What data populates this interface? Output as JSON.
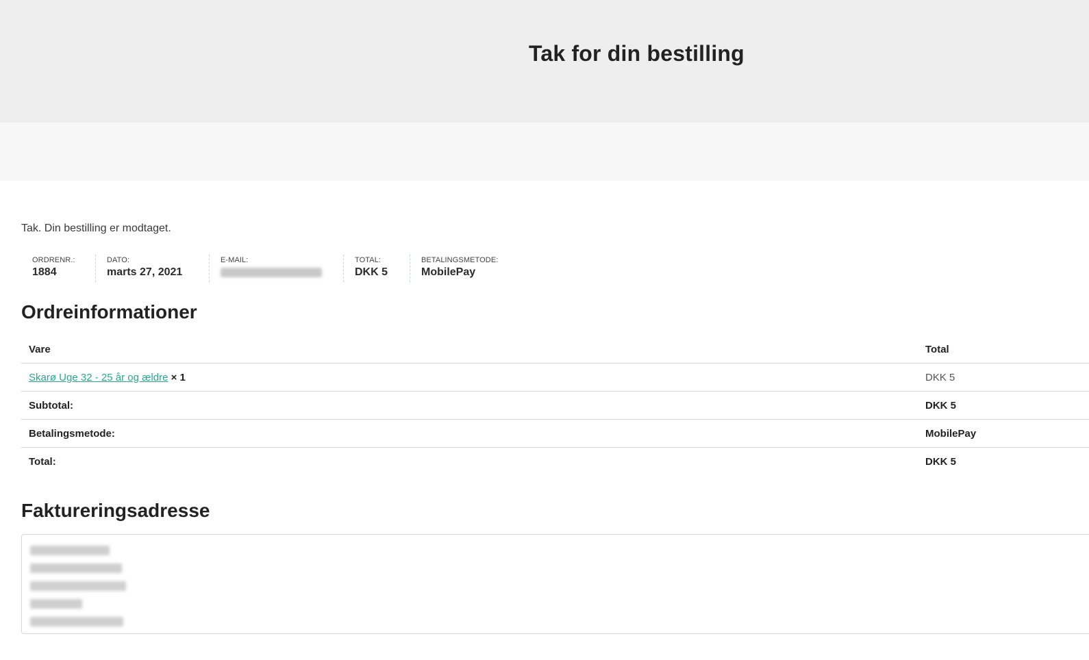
{
  "header": {
    "title": "Tak for din bestilling"
  },
  "notice": "Tak. Din bestilling er modtaget.",
  "overview": [
    {
      "label": "ORDRENR.:",
      "value": "1884"
    },
    {
      "label": "DATO:",
      "value": "marts 27, 2021"
    },
    {
      "label": "E-MAIL:",
      "value": ""
    },
    {
      "label": "TOTAL:",
      "value": "DKK 5"
    },
    {
      "label": "BETALINGSMETODE:",
      "value": "MobilePay"
    }
  ],
  "order_details": {
    "heading": "Ordreinformationer",
    "columns": [
      "Vare",
      "Total"
    ],
    "item": {
      "name": "Skarø Uge 32 -   25 år og ældre",
      "qty": "× 1",
      "total": "DKK 5"
    },
    "rows": [
      {
        "label": "Subtotal:",
        "value": "DKK 5"
      },
      {
        "label": "Betalingsmetode:",
        "value": "MobilePay"
      },
      {
        "label": "Total:",
        "value": "DKK 5"
      }
    ]
  },
  "billing": {
    "heading": "Faktureringsadresse"
  }
}
